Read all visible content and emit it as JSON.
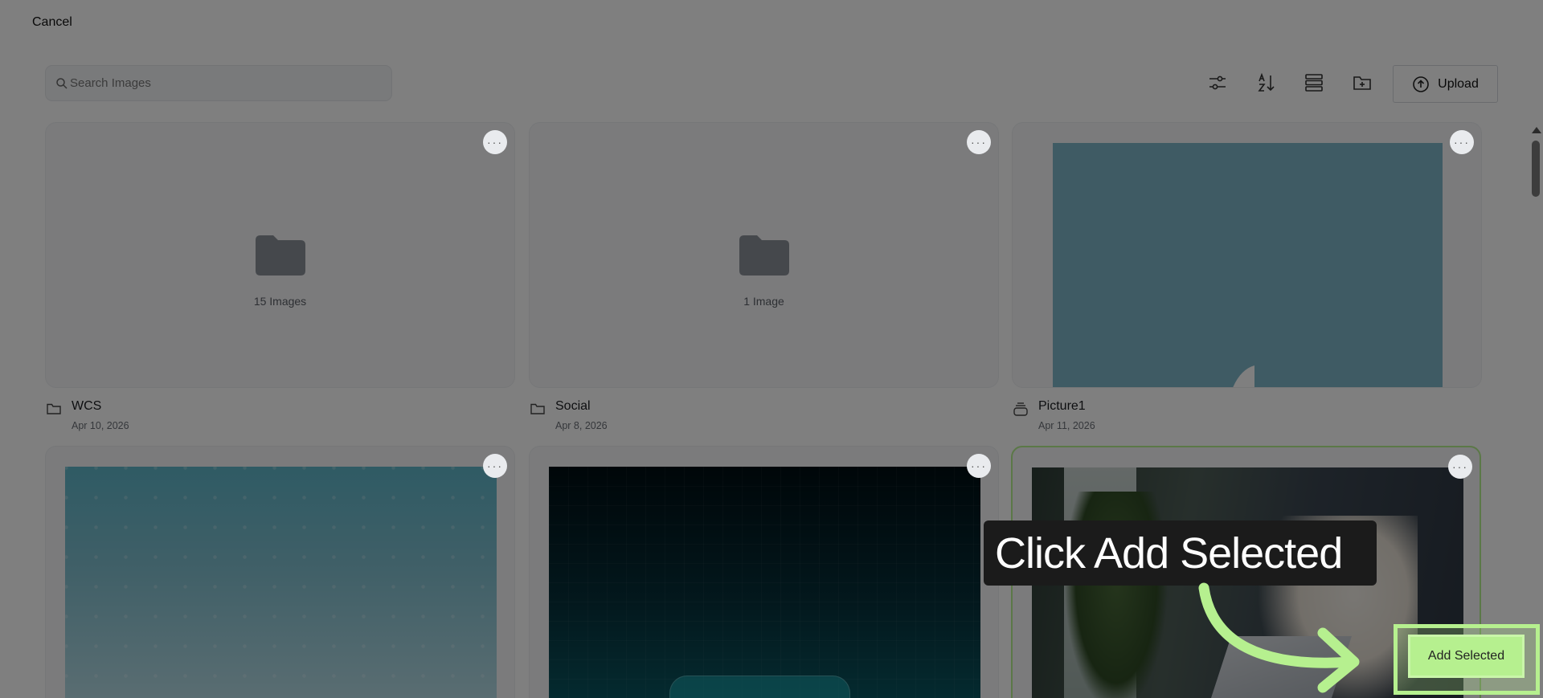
{
  "header": {
    "cancel_label": "Cancel"
  },
  "search": {
    "placeholder": "Search Images",
    "value": ""
  },
  "toolbar": {
    "icons": [
      "filter-sliders-icon",
      "sort-az-icon",
      "list-view-icon",
      "new-folder-icon",
      "upload-cloud-icon"
    ],
    "upload_label": "Upload"
  },
  "cards": [
    {
      "type": "folder",
      "title": "WCS",
      "date": "Apr 10, 2026",
      "count_label": "15 Images",
      "more": "···"
    },
    {
      "type": "folder",
      "title": "Social",
      "date": "Apr 8, 2026",
      "count_label": "1 Image",
      "more": "···"
    },
    {
      "type": "image",
      "title": "Picture1",
      "date": "Apr 11, 2026",
      "more": "···"
    },
    {
      "type": "image",
      "more": "···"
    },
    {
      "type": "image",
      "more": "···"
    },
    {
      "type": "image",
      "selected": true,
      "more": "···"
    }
  ],
  "footer": {
    "add_selected_label": "Add Selected"
  },
  "guide": {
    "tooltip": "Click Add Selected"
  },
  "colors": {
    "accent": "#b6f08f",
    "overlay": "rgba(0,0,0,0.5)",
    "tooltip_bg": "#1b1b1b"
  }
}
